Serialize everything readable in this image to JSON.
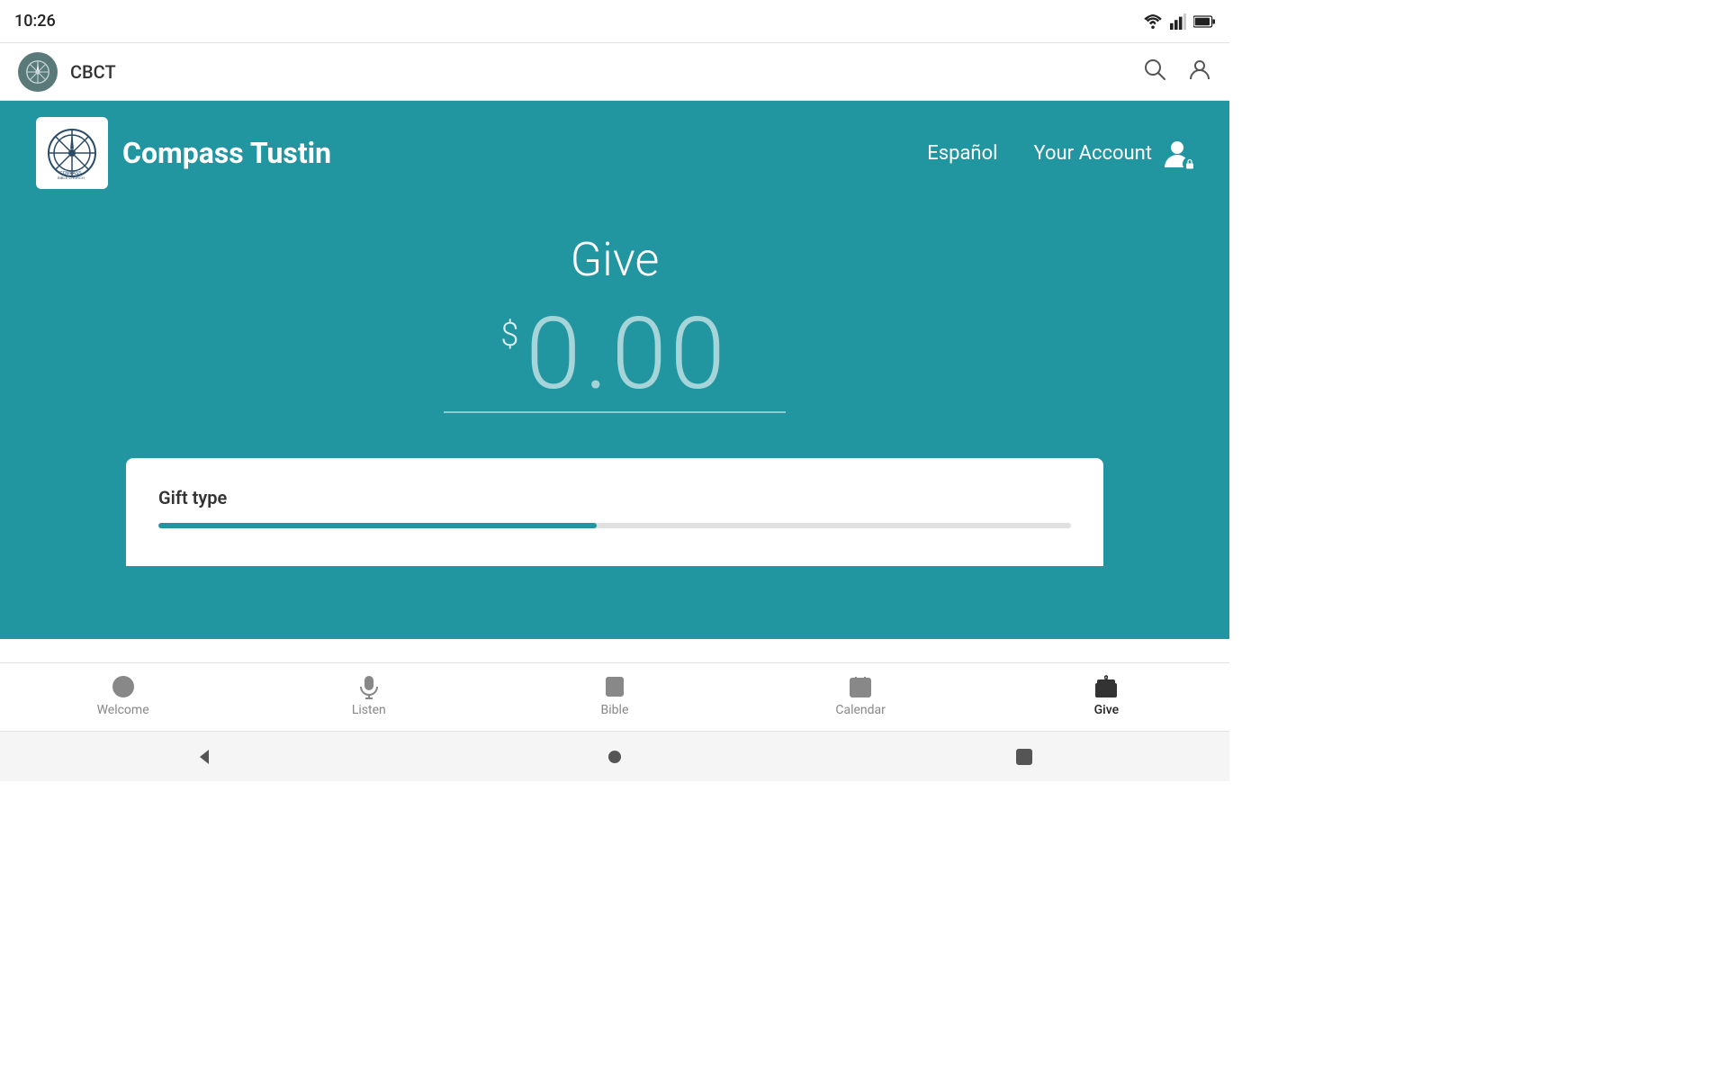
{
  "statusBar": {
    "time": "10:26"
  },
  "appBar": {
    "title": "CBCT"
  },
  "churchHeader": {
    "name": "Compass Tustin",
    "espanol": "Español",
    "yourAccount": "Your Account"
  },
  "give": {
    "title": "Give",
    "currencySymbol": "$",
    "amount": "0.00"
  },
  "giftType": {
    "label": "Gift type"
  },
  "bottomNav": {
    "items": [
      {
        "label": "Welcome",
        "icon": "chat-icon",
        "active": false
      },
      {
        "label": "Listen",
        "icon": "mic-icon",
        "active": false
      },
      {
        "label": "Bible",
        "icon": "bible-icon",
        "active": false
      },
      {
        "label": "Calendar",
        "icon": "calendar-icon",
        "active": false
      },
      {
        "label": "Give",
        "icon": "gift-icon",
        "active": true
      }
    ]
  },
  "androidNav": {
    "back": "back-icon",
    "home": "home-icon",
    "recents": "recents-icon"
  }
}
